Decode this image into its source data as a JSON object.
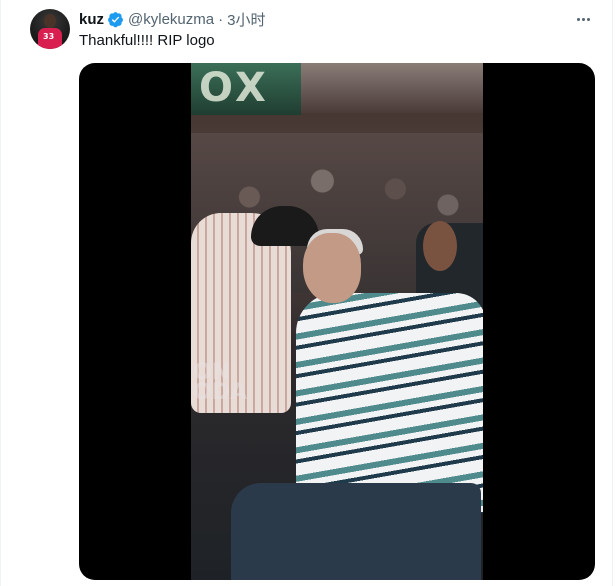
{
  "tweet": {
    "author_name": "kuz",
    "handle": "@kylekuzma",
    "separator": "·",
    "time": "3小时",
    "text": "Thankful!!!! RIP logo",
    "verified": true
  },
  "avatar": {
    "jersey_number": "33",
    "jersey_color": "#d81f4f"
  },
  "icons": {
    "verified": "verified-badge-icon",
    "more": "more-options-icon"
  },
  "media": {
    "type": "video"
  },
  "colors": {
    "accent": "#1d9bf0",
    "secondary_text": "#536471",
    "primary_text": "#0f1419"
  }
}
